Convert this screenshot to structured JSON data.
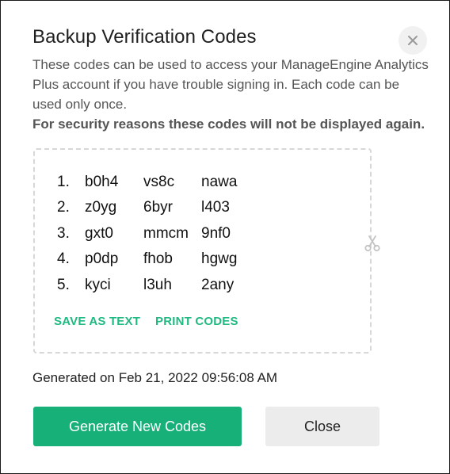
{
  "dialog": {
    "title": "Backup Verification Codes",
    "description": "These codes can be used to access your ManageEngine Analytics Plus account if you have trouble signing in. Each code can be used only once.",
    "warning": "For security reasons these codes will not be displayed again.",
    "codes": [
      {
        "num": "1.",
        "c1": "b0h4",
        "c2": "vs8c",
        "c3": "nawa"
      },
      {
        "num": "2.",
        "c1": "z0yg",
        "c2": "6byr",
        "c3": "l403"
      },
      {
        "num": "3.",
        "c1": "gxt0",
        "c2": "mmcm",
        "c3": "9nf0"
      },
      {
        "num": "4.",
        "c1": "p0dp",
        "c2": "fhob",
        "c3": "hgwg"
      },
      {
        "num": "5.",
        "c1": "kyci",
        "c2": "l3uh",
        "c3": "2any"
      }
    ],
    "save_as_text_label": "SAVE AS TEXT",
    "print_codes_label": "PRINT CODES",
    "generated_text": "Generated on Feb 21, 2022 09:56:08 AM",
    "generate_button_label": "Generate New Codes",
    "close_button_label": "Close",
    "icons": {
      "close": "close-icon",
      "scissors": "scissors-icon"
    },
    "colors": {
      "accent": "#18b079",
      "link": "#20b981",
      "secondary_button": "#ececec"
    }
  }
}
